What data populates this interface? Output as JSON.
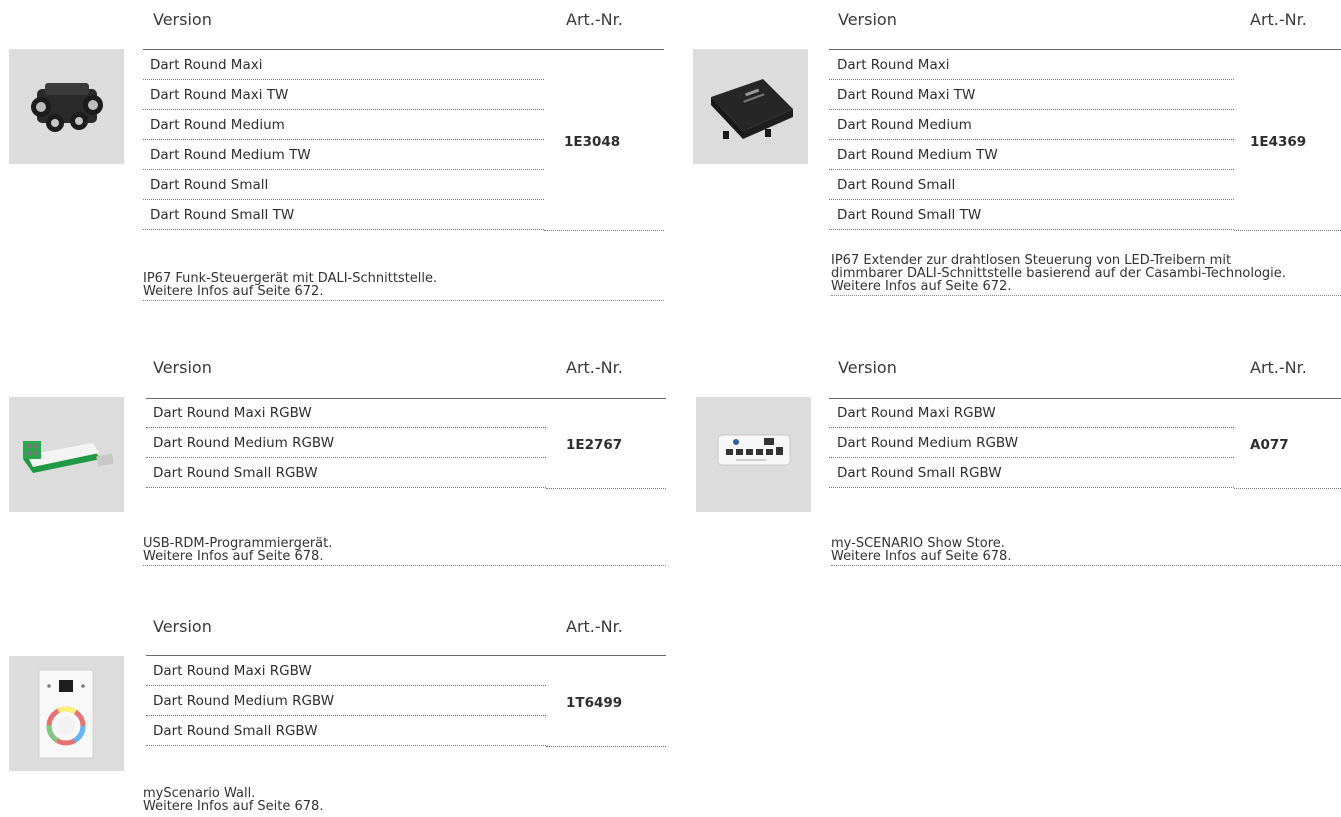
{
  "headers": {
    "version": "Version",
    "art_nr": "Art.-Nr."
  },
  "products": [
    {
      "art_nr": "1E3048",
      "versions": [
        "Dart Round Maxi",
        "Dart Round Maxi TW",
        "Dart Round Medium",
        "Dart Round Medium TW",
        "Dart Round Small",
        "Dart Round Small TW"
      ],
      "description": [
        "IP67 Funk-Steuergerät mit DALI-Schnittstelle.",
        "Weitere Infos auf Seite 672."
      ],
      "image_icon": "black-junction-box-device-image"
    },
    {
      "art_nr": "1E4369",
      "versions": [
        "Dart Round Maxi",
        "Dart Round Maxi TW",
        "Dart Round Medium",
        "Dart Round Medium TW",
        "Dart Round Small",
        "Dart Round Small TW"
      ],
      "description": [
        "IP67 Extender zur drahtlosen Steuerung von LED-Treibern mit",
        "dimmbarer DALI-Schnittstelle basierend auf der Casambi-Technologie.",
        "Weitere Infos auf Seite 672."
      ],
      "image_icon": "black-extender-module-image"
    },
    {
      "art_nr": "1E2767",
      "versions": [
        "Dart Round Maxi RGBW",
        "Dart Round Medium RGBW",
        "Dart Round Small RGBW"
      ],
      "description": [
        "USB-RDM-Programmiergerät.",
        "Weitere Infos auf Seite 678."
      ],
      "image_icon": "usb-programmer-image"
    },
    {
      "art_nr": "A077",
      "versions": [
        "Dart Round Maxi RGBW",
        "Dart Round Medium RGBW",
        "Dart Round Small RGBW"
      ],
      "description": [
        "my-SCENARIO Show Store.",
        "Weitere Infos auf Seite 678."
      ],
      "image_icon": "show-store-device-image"
    },
    {
      "art_nr": "1T6499",
      "versions": [
        "Dart Round Maxi RGBW",
        "Dart Round Medium RGBW",
        "Dart Round Small RGBW"
      ],
      "description": [
        "myScenario Wall.",
        "Weitere Infos auf Seite 678."
      ],
      "image_icon": "wall-panel-touch-controller-image"
    }
  ]
}
